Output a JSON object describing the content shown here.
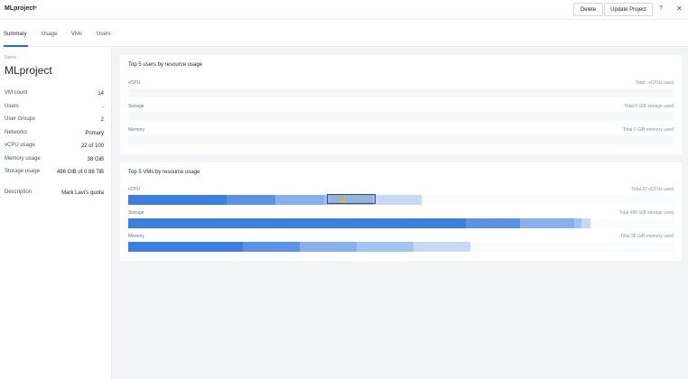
{
  "header": {
    "project_title": "MLproject",
    "caret_icon": "chevron-down-icon",
    "delete_label": "Delete",
    "update_label": "Update Project",
    "help_icon": "?",
    "close_icon": "✕"
  },
  "tabs": [
    {
      "label": "Summary",
      "active": true
    },
    {
      "label": "Usage",
      "active": false
    },
    {
      "label": "VMs",
      "active": false
    },
    {
      "label": "Users",
      "active": false
    }
  ],
  "details": {
    "name_label": "Name",
    "name_value": "MLproject",
    "rows": [
      {
        "key": "VM count",
        "value": "14"
      },
      {
        "key": "Users",
        "value": "-"
      },
      {
        "key": "User Groups",
        "value": "2"
      },
      {
        "key": "Networks",
        "value": "Primary"
      },
      {
        "key": "vCPU usage",
        "value": "22 of 100"
      },
      {
        "key": "Memory usage",
        "value": "38 GiB"
      },
      {
        "key": "Storage usage",
        "value": "496 GiB of 0.98 TiB"
      },
      {
        "key": "Description",
        "value": "Mark Lavi's quota"
      }
    ]
  },
  "top_users": {
    "title": "Top 5 users by resource usage",
    "rows": [
      {
        "label": "vCPU",
        "total": "Total : vCPUs used"
      },
      {
        "label": "Storage",
        "total": "Total 0 GiB storage used"
      },
      {
        "label": "Memory",
        "total": "Total 0 GiB memory used"
      }
    ]
  },
  "top_vms": {
    "title": "Top 5 VMs by resource usage",
    "rows": [
      {
        "label": "vCPU",
        "total": "Total 22 vCPUs used",
        "segments": [
          0.18,
          0.09,
          0.09,
          0.09,
          0.09
        ],
        "colors": [
          "#3b7fe0",
          "#5a93e6",
          "#86b1ee",
          "#a3c4f2",
          "#c4daf8"
        ]
      },
      {
        "label": "Storage",
        "total": "Total 496 GiB storage used",
        "segments": [
          0.62,
          0.1,
          0.1,
          0.014,
          0.016
        ],
        "colors": [
          "#3b7fe0",
          "#5a93e6",
          "#86b1ee",
          "#a3c4f2",
          "#c4daf8"
        ]
      },
      {
        "label": "Memory",
        "total": "Total 38 GiB memory used",
        "segments": [
          0.21,
          0.105,
          0.105,
          0.105,
          0.105
        ],
        "colors": [
          "#3b7fe0",
          "#5a93e6",
          "#86b1ee",
          "#a3c4f2",
          "#c4daf8"
        ]
      }
    ]
  }
}
